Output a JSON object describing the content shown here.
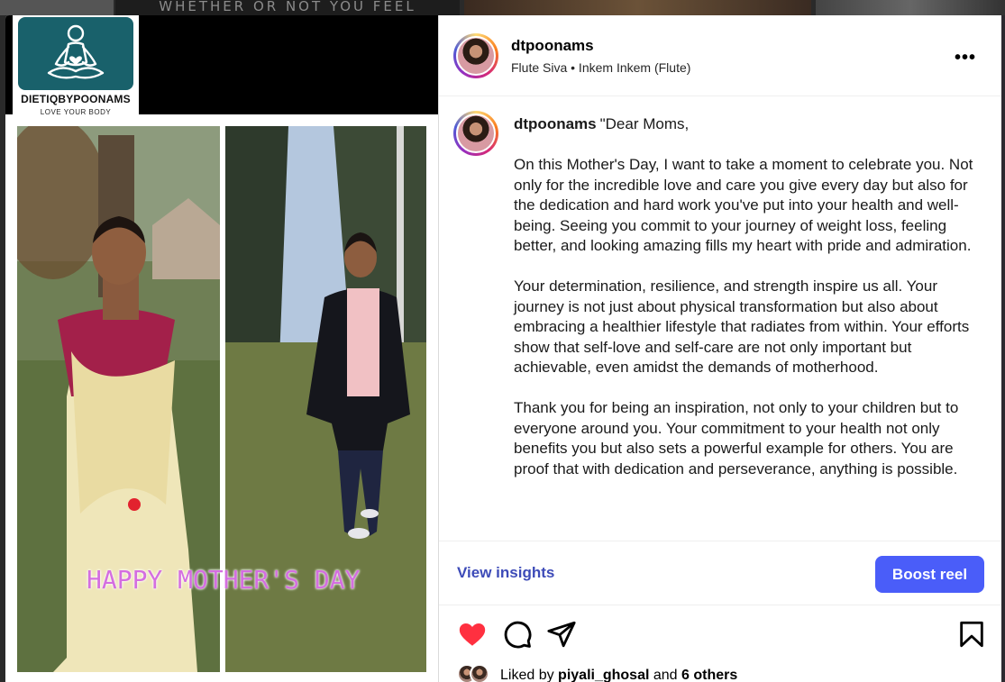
{
  "background": {
    "banner_text": "WHETHER OR NOT YOU FEEL"
  },
  "media": {
    "logo_name": "DIETIQBYPOONAMS",
    "logo_tagline": "LOVE YOUR BODY",
    "overlay_text": "HAPPY MOTHER'S DAY"
  },
  "post": {
    "username": "dtpoonams",
    "audio": "Flute Siva • Inkem Inkem (Flute)",
    "more_label": "•••",
    "caption_opening": "\"Dear Moms,",
    "caption_paragraphs": [
      "On this Mother's Day, I want to take a moment to celebrate you. Not only for the incredible love and care you give every day but also for the dedication and hard work you've put into your health and well-being. Seeing you commit to your journey of weight loss, feeling better, and looking amazing fills my heart with pride and admiration.",
      "Your determination, resilience, and strength inspire us all. Your journey is not just about physical transformation but also about embracing a healthier lifestyle that radiates from within. Your efforts show that self-love and self-care are not only important but achievable, even amidst the demands of motherhood.",
      "Thank you for being an inspiration, not only to your children but to everyone around you. Your commitment to your health not only benefits you but also sets a powerful example for others. You are proof that with dedication and perseverance, anything is possible."
    ],
    "view_insights": "View insights",
    "boost_label": "Boost reel",
    "likes_prefix": "Liked by ",
    "likes_user": "piyali_ghosal",
    "likes_mid": " and ",
    "likes_others": "6 others"
  },
  "icons": {
    "heart": "heart-filled-icon",
    "comment": "comment-icon",
    "share": "share-icon",
    "save": "bookmark-icon"
  },
  "colors": {
    "like_red": "#ff3040",
    "boost_blue": "#4a5df9",
    "insights_blue": "#3d4bb8",
    "logo_teal": "#19616b",
    "overlay_pink": "#d46ee0"
  }
}
